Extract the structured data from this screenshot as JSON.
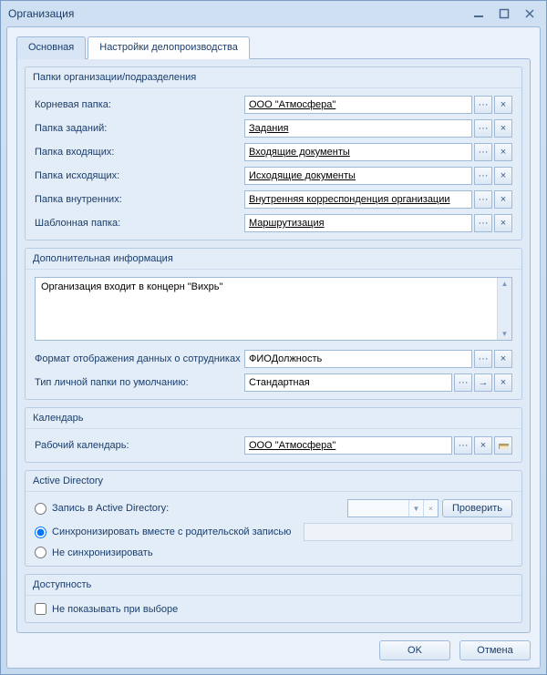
{
  "window": {
    "title": "Организация"
  },
  "tabs": {
    "main": "Основная",
    "settings": "Настройки делопроизводства"
  },
  "groups": {
    "folders": {
      "title": "Папки организации/подразделения",
      "rows": {
        "root": {
          "label": "Корневая папка:",
          "value": "ООО \"Атмосфера\""
        },
        "tasks": {
          "label": "Папка заданий:",
          "value": "Задания"
        },
        "incoming": {
          "label": "Папка входящих:",
          "value": "Входящие документы"
        },
        "outgoing": {
          "label": "Папка исходящих:",
          "value": "Исходящие документы"
        },
        "internal": {
          "label": "Папка внутренних:",
          "value": "Внутренняя корреспонденция организации"
        },
        "template": {
          "label": "Шаблонная папка:",
          "value": "Маршрутизация"
        }
      }
    },
    "extra": {
      "title": "Дополнительная информация",
      "memo": "Организация входит в концерн \"Вихрь\"",
      "format": {
        "label": "Формат отображения данных о сотрудниках",
        "value": "ФИОДолжность"
      },
      "foldert": {
        "label": "Тип личной папки по умолчанию:",
        "value": "Стандартная"
      }
    },
    "calendar": {
      "title": "Календарь",
      "row": {
        "label": "Рабочий календарь:",
        "value": "ООО \"Атмосфера\""
      }
    },
    "ad": {
      "title": "Active Directory",
      "opt_record": "Запись в Active Directory:",
      "opt_sync": "Синхронизировать вместе с родительской записью",
      "opt_none": "Не синхронизировать",
      "check_btn": "Проверить"
    },
    "avail": {
      "title": "Доступность",
      "hide": "Не показывать при выборе"
    }
  },
  "buttons": {
    "ellipsis": "···",
    "clear": "×",
    "arrow": "→",
    "ok": "OK",
    "cancel": "Отмена"
  }
}
